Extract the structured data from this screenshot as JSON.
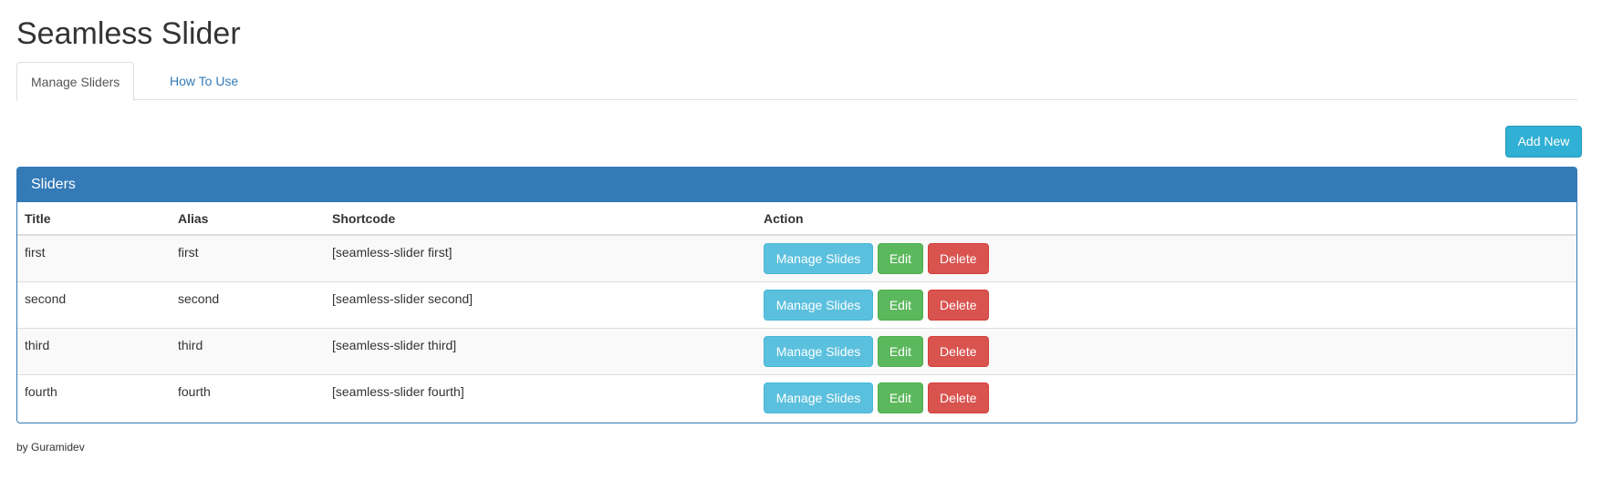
{
  "page": {
    "title": "Seamless Slider",
    "footer": "by Guramidev"
  },
  "tabs": [
    {
      "label": "Manage Sliders",
      "active": true
    },
    {
      "label": "How To Use",
      "active": false
    }
  ],
  "toolbar": {
    "add_new_label": "Add New"
  },
  "panel": {
    "heading": "Sliders",
    "columns": [
      "Title",
      "Alias",
      "Shortcode",
      "Action"
    ],
    "rows": [
      {
        "title": "first",
        "alias": "first",
        "shortcode": "[seamless-slider first]"
      },
      {
        "title": "second",
        "alias": "second",
        "shortcode": "[seamless-slider second]"
      },
      {
        "title": "third",
        "alias": "third",
        "shortcode": "[seamless-slider third]"
      },
      {
        "title": "fourth",
        "alias": "fourth",
        "shortcode": "[seamless-slider fourth]"
      }
    ],
    "actions": {
      "manage_label": "Manage Slides",
      "edit_label": "Edit",
      "delete_label": "Delete"
    }
  },
  "colors": {
    "primary": "#337ab7",
    "info": "#5bc0de",
    "success": "#5cb85c",
    "danger": "#d9534f",
    "add_new": "#31b0d5"
  }
}
